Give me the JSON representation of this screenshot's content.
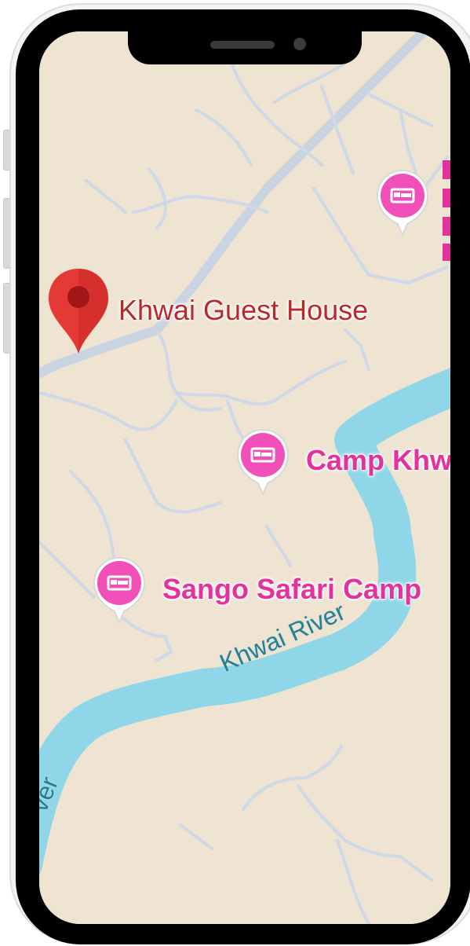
{
  "map": {
    "place_labels": {
      "guest_house": "Khwai Guest House",
      "camp": "Camp Khw",
      "sango": "Sango Safari Camp"
    },
    "water_labels": {
      "river_main": "Khwai River",
      "river_left": "ver"
    },
    "icons": {
      "location_pin": "red-location-pin-icon",
      "lodging": "bed-icon"
    },
    "colors": {
      "land": "#efe3d1",
      "water": "#8fd7e8",
      "road": "#c9d4e2",
      "pin": "#e53935",
      "poi": "#f050b8"
    }
  }
}
